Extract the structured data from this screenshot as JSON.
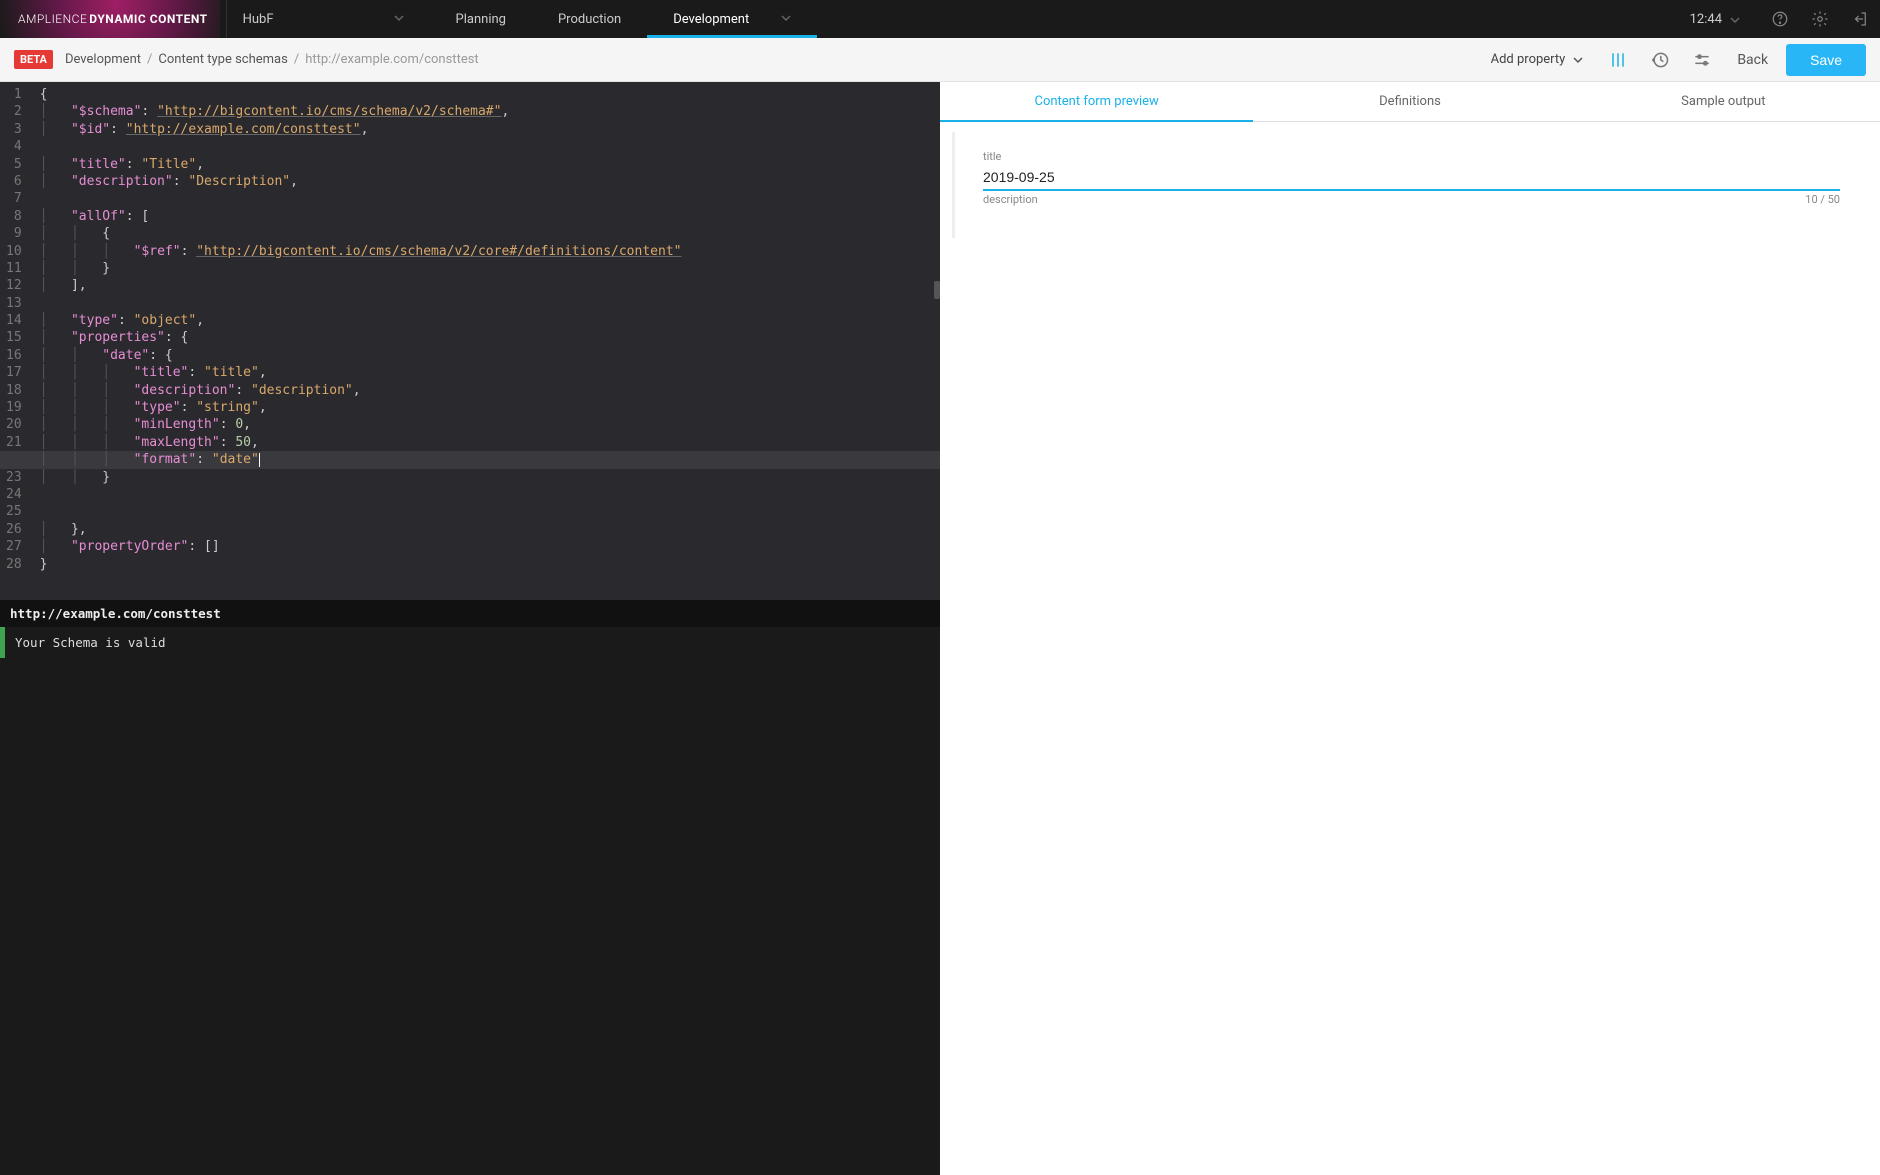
{
  "brand": {
    "light": "AMPLIENCE",
    "bold": "DYNAMIC CONTENT"
  },
  "hub": {
    "name": "HubF"
  },
  "nav": {
    "tabs": [
      "Planning",
      "Production",
      "Development"
    ],
    "active": "Development"
  },
  "time": "12:44",
  "subheader": {
    "beta": "BETA",
    "crumbs": [
      "Development",
      "Content type schemas",
      "http://example.com/consttest"
    ],
    "addProperty": "Add property",
    "back": "Back",
    "save": "Save"
  },
  "editor": {
    "lines": [
      "{",
      "    \"$schema\": \"http://bigcontent.io/cms/schema/v2/schema#\",",
      "    \"$id\": \"http://example.com/consttest\",",
      "",
      "    \"title\": \"Title\",",
      "    \"description\": \"Description\",",
      "",
      "    \"allOf\": [",
      "        {",
      "            \"$ref\": \"http://bigcontent.io/cms/schema/v2/core#/definitions/content\"",
      "        }",
      "    ],",
      "",
      "    \"type\": \"object\",",
      "    \"properties\": {",
      "        \"date\": {",
      "            \"title\": \"title\",",
      "            \"description\": \"description\",",
      "            \"type\": \"string\",",
      "            \"minLength\": 0,",
      "            \"maxLength\": 50,",
      "            \"format\": \"date\"",
      "        }",
      "",
      "",
      "    },",
      "    \"propertyOrder\": []",
      "}"
    ],
    "activeLine": 22
  },
  "status": {
    "url": "http://example.com/consttest",
    "message": "Your Schema is valid"
  },
  "preview": {
    "tabs": [
      "Content form preview",
      "Definitions",
      "Sample output"
    ],
    "activeTab": "Content form preview",
    "form": {
      "titleLabel": "title",
      "titleValue": "2019-09-25",
      "descLabel": "description",
      "counter": "10 / 50"
    }
  }
}
